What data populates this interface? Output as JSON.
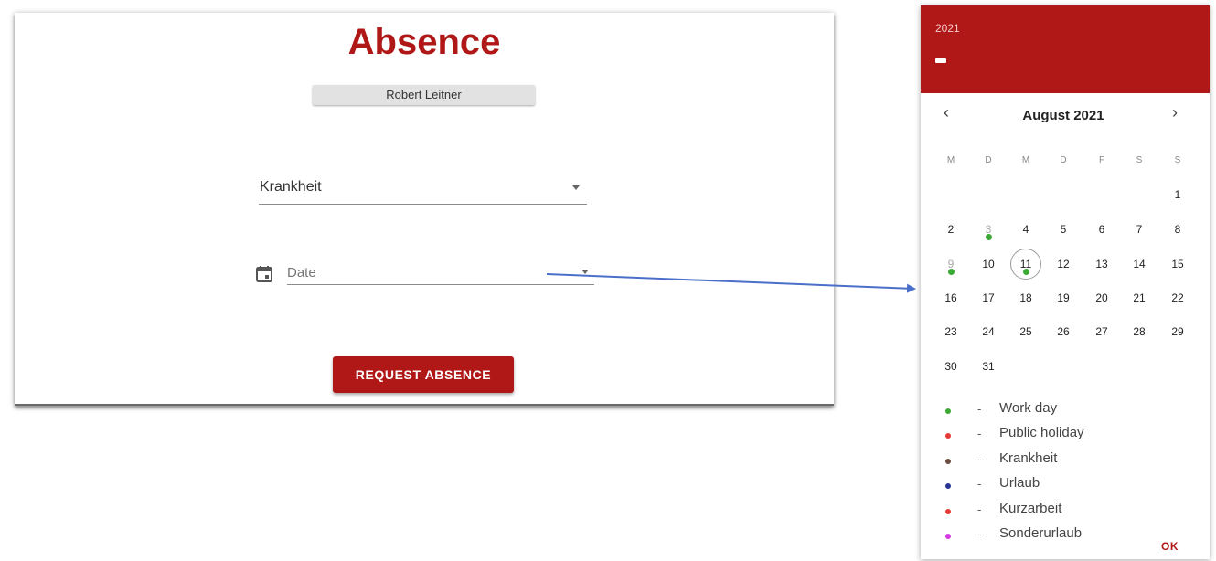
{
  "form": {
    "title": "Absence",
    "person": "Robert Leitner",
    "absence_type": "Krankheit",
    "date_placeholder": "Date",
    "submit_label": "REQUEST ABSENCE"
  },
  "picker": {
    "year": "2021",
    "month_label": "August 2021",
    "prev_icon": "chevron-left-icon",
    "next_icon": "chevron-right-icon",
    "weekdays": [
      "M",
      "D",
      "M",
      "D",
      "F",
      "S",
      "S"
    ],
    "weeks": [
      [
        "",
        "",
        "",
        "",
        "",
        "",
        "1"
      ],
      [
        "2",
        "3",
        "4",
        "5",
        "6",
        "7",
        "8"
      ],
      [
        "9",
        "10",
        "11",
        "12",
        "13",
        "14",
        "15"
      ],
      [
        "16",
        "17",
        "18",
        "19",
        "20",
        "21",
        "22"
      ],
      [
        "23",
        "24",
        "25",
        "26",
        "27",
        "28",
        "29"
      ],
      [
        "30",
        "31",
        "",
        "",
        "",
        "",
        ""
      ]
    ],
    "legend": [
      {
        "separator": "-",
        "label": "Work day",
        "color": "#3aaa35"
      },
      {
        "separator": "-",
        "label": "Public holiday",
        "color": "#e53935"
      },
      {
        "separator": "-",
        "label": "Krankheit",
        "color": "#6d4c41"
      },
      {
        "separator": "-",
        "label": "Urlaub",
        "color": "#283593"
      },
      {
        "separator": "-",
        "label": "Kurzarbeit",
        "color": "#e53935"
      },
      {
        "separator": "-",
        "label": "Sonderurlaub",
        "color": "#d63be0"
      }
    ],
    "ok_label": "OK"
  },
  "colors": {
    "accent": "#b01717",
    "work_day_marker": "#3aaa35",
    "arrow": "#4a6fc8"
  }
}
